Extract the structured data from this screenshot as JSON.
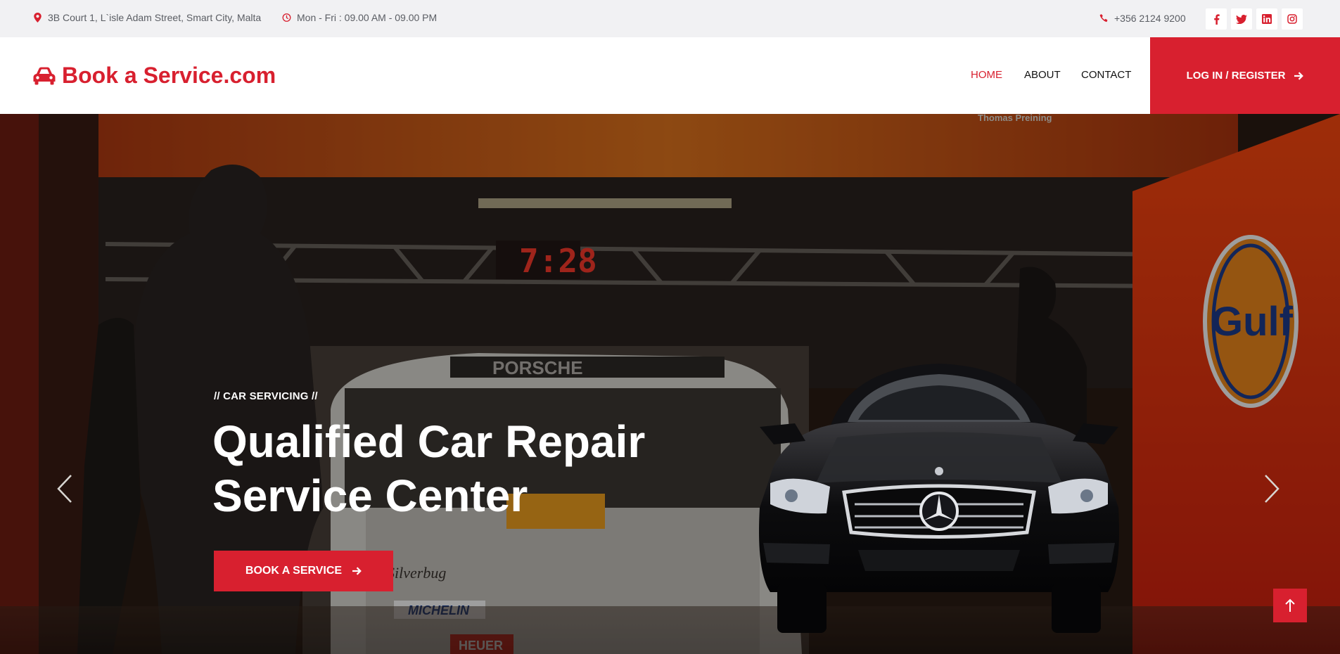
{
  "topbar": {
    "address": "3B Court 1, L`isle Adam Street, Smart City, Malta",
    "hours": "Mon - Fri : 09.00 AM - 09.00 PM",
    "phone": "+356 2124 9200",
    "socials": [
      "facebook-icon",
      "twitter-icon",
      "linkedin-icon",
      "instagram-icon"
    ]
  },
  "header": {
    "logo_text": "Book a Service.com",
    "nav": {
      "home": "HOME",
      "about": "ABOUT",
      "contact": "CONTACT"
    },
    "login_label": "LOG IN / REGISTER"
  },
  "hero": {
    "eyebrow": "// CAR SERVICING //",
    "headline": "Qualified Car Repair Service Center",
    "cta_label": "BOOK A SERVICE",
    "signage": {
      "clock": "7:28",
      "gulf": "Gulf",
      "michelin": "MICHELIN",
      "heuer": "HEUER",
      "porsche": "PORSCHE",
      "silverbug": "Silverbug",
      "driver": "Thomas Preining"
    }
  },
  "colors": {
    "brand_red": "#d8202f",
    "topbar_bg": "#f1f1f3",
    "text_dark": "#111111"
  }
}
